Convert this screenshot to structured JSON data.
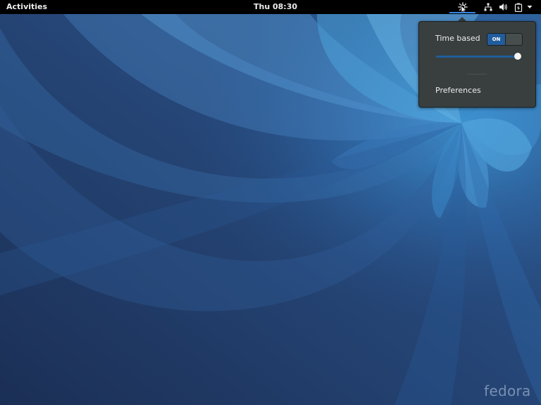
{
  "topbar": {
    "activities_label": "Activities",
    "clock": "Thu 08:30"
  },
  "tray": {
    "icons": [
      "night-light-icon",
      "network-wired-icon",
      "volume-icon",
      "battery-icon",
      "system-menu-arrow-icon"
    ]
  },
  "popover": {
    "time_based_label": "Time based",
    "toggle_state": "ON",
    "slider_value": 1.0,
    "preferences_label": "Preferences"
  },
  "desktop": {
    "logo_text": "fedora"
  },
  "colors": {
    "accent": "#215d9c",
    "topbar": "#000000",
    "popover_bg": "#393f3f",
    "wallpaper_dark": "#1e3a66",
    "wallpaper_light": "#4a9fd6"
  }
}
